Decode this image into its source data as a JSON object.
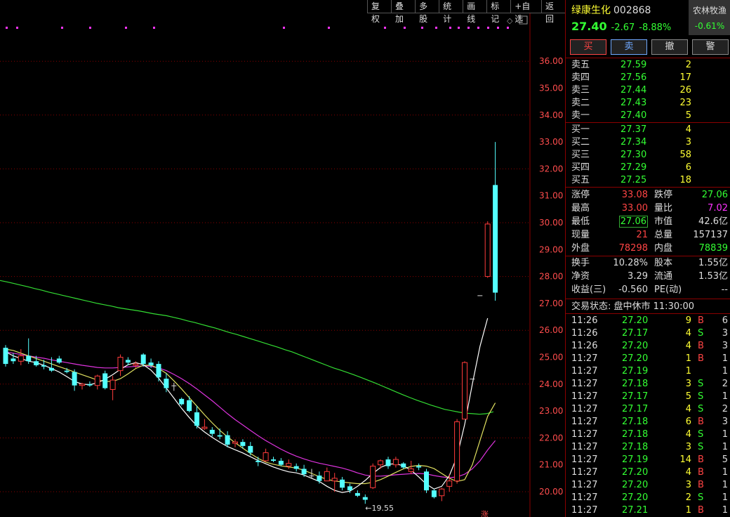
{
  "toolbar": [
    "复权",
    "叠加",
    "多股",
    "统计",
    "画线",
    "标记",
    "+自选",
    "返回"
  ],
  "chart": {
    "y_ticks": [
      "36.00",
      "35.00",
      "34.00",
      "33.00",
      "32.00",
      "31.00",
      "30.00",
      "29.00",
      "28.00",
      "27.00",
      "26.00",
      "25.00",
      "24.00",
      "23.00",
      "22.00",
      "21.00",
      "20.00"
    ],
    "low_label": "19.55",
    "bottom_mark": "涨",
    "candles": [
      [
        25.35,
        25.45,
        24.65,
        24.75
      ],
      [
        24.95,
        25.15,
        24.75,
        24.85
      ],
      [
        24.85,
        25.3,
        24.7,
        25.05
      ],
      [
        25.05,
        25.7,
        24.75,
        24.85
      ],
      [
        24.85,
        25.05,
        24.65,
        24.7
      ],
      [
        24.7,
        24.9,
        24.55,
        24.65
      ],
      [
        24.6,
        25.0,
        24.45,
        24.5
      ],
      [
        24.95,
        25.05,
        24.75,
        24.8
      ],
      [
        24.5,
        24.6,
        24.4,
        24.45
      ],
      [
        24.45,
        24.55,
        23.75,
        23.95
      ],
      [
        23.95,
        24.05,
        23.8,
        24.0
      ],
      [
        24.0,
        24.1,
        23.9,
        23.95
      ],
      [
        23.95,
        24.35,
        23.8,
        24.3
      ],
      [
        24.4,
        24.5,
        23.8,
        23.85
      ],
      [
        23.8,
        24.3,
        23.4,
        24.15
      ],
      [
        24.5,
        25.1,
        24.3,
        25.0
      ],
      [
        24.9,
        25.0,
        24.7,
        24.8
      ],
      [
        24.7,
        24.85,
        24.6,
        24.75
      ],
      [
        25.1,
        25.15,
        24.65,
        24.75
      ],
      [
        24.8,
        24.95,
        24.6,
        24.7
      ],
      [
        24.75,
        24.85,
        24.1,
        24.25
      ],
      [
        24.2,
        24.4,
        23.7,
        23.85
      ],
      [
        23.95,
        24.05,
        23.75,
        23.95
      ],
      [
        23.45,
        23.5,
        23.2,
        23.25
      ],
      [
        23.4,
        23.55,
        22.95,
        23.0
      ],
      [
        22.95,
        23.2,
        22.35,
        22.45
      ],
      [
        22.35,
        22.7,
        22.3,
        22.4
      ],
      [
        22.3,
        22.4,
        22.05,
        22.15
      ],
      [
        22.1,
        22.35,
        21.95,
        22.05
      ],
      [
        22.1,
        22.25,
        21.65,
        21.75
      ],
      [
        21.8,
        21.95,
        21.65,
        21.85
      ],
      [
        21.85,
        21.95,
        21.6,
        21.7
      ],
      [
        21.7,
        21.85,
        21.35,
        21.45
      ],
      [
        21.15,
        21.3,
        20.95,
        21.1
      ],
      [
        21.15,
        21.6,
        21.1,
        21.45
      ],
      [
        21.2,
        21.3,
        21.1,
        21.15
      ],
      [
        21.15,
        21.25,
        20.95,
        21.0
      ],
      [
        20.95,
        21.2,
        20.85,
        21.05
      ],
      [
        20.95,
        21.05,
        20.75,
        20.85
      ],
      [
        20.85,
        21.0,
        20.55,
        20.65
      ],
      [
        20.6,
        20.85,
        20.5,
        20.6
      ],
      [
        20.6,
        20.75,
        20.3,
        20.4
      ],
      [
        20.4,
        20.9,
        20.4,
        20.75
      ],
      [
        20.4,
        20.7,
        20.0,
        20.5
      ],
      [
        20.45,
        20.55,
        20.05,
        20.15
      ],
      [
        20.2,
        20.3,
        19.95,
        20.05
      ],
      [
        19.95,
        20.05,
        19.8,
        19.85
      ],
      [
        19.8,
        19.9,
        19.55,
        19.7
      ],
      [
        20.15,
        21.05,
        20.1,
        20.95
      ],
      [
        21.0,
        21.2,
        20.85,
        21.15
      ],
      [
        21.2,
        21.3,
        20.85,
        20.95
      ],
      [
        21.0,
        21.3,
        20.9,
        21.2
      ],
      [
        21.05,
        21.1,
        20.85,
        20.9
      ],
      [
        20.75,
        21.15,
        20.65,
        20.85
      ],
      [
        20.95,
        21.05,
        20.8,
        20.9
      ],
      [
        20.75,
        20.85,
        19.95,
        20.05
      ],
      [
        20.05,
        20.1,
        19.75,
        19.8
      ],
      [
        19.85,
        20.15,
        19.65,
        20.1
      ],
      [
        20.2,
        20.65,
        20.0,
        20.4
      ],
      [
        20.4,
        22.7,
        20.3,
        22.6
      ],
      [
        22.7,
        24.85,
        22.7,
        24.8
      ],
      [
        24.2,
        24.2,
        24.2,
        24.2
      ],
      [
        27.3,
        27.3,
        27.3,
        27.3
      ],
      [
        28.0,
        30.05,
        27.95,
        29.95
      ],
      [
        31.4,
        33.0,
        27.1,
        27.4
      ]
    ],
    "ma_green": [
      27.85,
      27.8,
      27.74,
      27.68,
      27.62,
      27.55,
      27.49,
      27.42,
      27.36,
      27.3,
      27.24,
      27.18,
      27.12,
      27.06,
      27.0,
      26.95,
      26.9,
      26.84,
      26.8,
      26.76,
      26.72,
      26.67,
      26.62,
      26.58,
      26.54,
      26.48,
      26.42,
      26.35,
      26.29,
      26.22,
      26.15,
      26.08,
      26.0,
      25.92,
      25.85,
      25.77,
      25.69,
      25.61,
      25.53,
      25.45,
      25.37,
      25.28,
      25.2,
      25.1,
      25.0,
      24.9,
      24.8,
      24.7,
      24.6,
      24.52,
      24.43,
      24.34,
      24.24,
      24.14,
      24.04,
      23.93,
      23.82,
      23.71,
      23.6,
      23.5,
      23.4,
      23.31,
      23.22,
      23.14,
      23.06,
      23.01,
      22.96,
      22.92,
      22.9,
      22.88,
      22.9,
      22.97
    ],
    "ma_magenta": [
      25.2,
      25.15,
      25.1,
      25.05,
      25.0,
      24.96,
      24.9,
      24.85,
      24.8,
      24.75,
      24.7,
      24.66,
      24.62,
      24.6,
      24.6,
      24.62,
      24.64,
      24.66,
      24.68,
      24.66,
      24.6,
      24.5,
      24.36,
      24.2,
      24.02,
      23.82,
      23.6,
      23.38,
      23.14,
      22.9,
      22.68,
      22.48,
      22.28,
      22.08,
      21.9,
      21.74,
      21.58,
      21.44,
      21.32,
      21.22,
      21.13,
      21.06,
      21.0,
      20.94,
      20.88,
      20.8,
      20.7,
      20.62,
      20.58,
      20.58,
      20.6,
      20.63,
      20.65,
      20.67,
      20.68,
      20.66,
      20.6,
      20.55,
      20.52,
      20.55,
      20.65,
      20.85,
      21.15,
      21.55,
      21.9
    ],
    "ma_yellow": [
      25.3,
      25.25,
      25.15,
      25.05,
      24.95,
      24.85,
      24.75,
      24.65,
      24.55,
      24.45,
      24.35,
      24.25,
      24.15,
      24.1,
      24.1,
      24.2,
      24.38,
      24.58,
      24.7,
      24.7,
      24.58,
      24.4,
      24.12,
      23.82,
      23.5,
      23.18,
      22.86,
      22.56,
      22.28,
      22.04,
      21.82,
      21.62,
      21.42,
      21.24,
      21.1,
      21.02,
      20.96,
      20.92,
      20.88,
      20.8,
      20.68,
      20.56,
      20.46,
      20.4,
      20.36,
      20.33,
      20.3,
      20.3,
      20.35,
      20.45,
      20.58,
      20.72,
      20.85,
      20.94,
      20.98,
      20.95,
      20.86,
      20.68,
      20.5,
      20.38,
      20.45,
      21.0,
      21.9,
      22.8,
      23.3
    ],
    "ma_white": [
      25.2,
      25.05,
      24.95,
      24.85,
      24.8,
      24.7,
      24.58,
      24.45,
      24.28,
      24.1,
      24.0,
      23.98,
      24.05,
      24.18,
      24.35,
      24.55,
      24.72,
      24.8,
      24.72,
      24.52,
      24.22,
      23.85,
      23.48,
      23.1,
      22.76,
      22.45,
      22.22,
      22.02,
      21.84,
      21.68,
      21.56,
      21.44,
      21.3,
      21.16,
      21.04,
      20.92,
      20.82,
      20.74,
      20.7,
      20.62,
      20.5,
      20.38,
      20.2,
      20.05,
      19.97,
      20.02,
      20.2,
      20.42,
      20.68,
      20.9,
      21.02,
      21.04,
      20.96,
      20.8,
      20.55,
      20.28,
      20.1,
      20.2,
      20.6,
      21.3,
      22.5,
      24.0,
      25.4,
      26.45
    ],
    "signal_dots": [
      8,
      23,
      87,
      127,
      178,
      218,
      403,
      467,
      547,
      575,
      600,
      620,
      640,
      652,
      666,
      680,
      694,
      708,
      722
    ]
  },
  "header": {
    "name": "绿康生化",
    "code": "002868",
    "sector": "农林牧渔",
    "sector_change": "-0.61%"
  },
  "quote": {
    "price": "27.40",
    "change": "-2.67",
    "change_pct": "-8.88%"
  },
  "trade_buttons": [
    "买",
    "卖",
    "撤",
    "警"
  ],
  "asks": [
    {
      "label": "卖五",
      "price": "27.59",
      "vol": "2"
    },
    {
      "label": "卖四",
      "price": "27.56",
      "vol": "17"
    },
    {
      "label": "卖三",
      "price": "27.44",
      "vol": "26"
    },
    {
      "label": "卖二",
      "price": "27.43",
      "vol": "23"
    },
    {
      "label": "卖一",
      "price": "27.40",
      "vol": "5"
    }
  ],
  "bids": [
    {
      "label": "买一",
      "price": "27.37",
      "vol": "4"
    },
    {
      "label": "买二",
      "price": "27.34",
      "vol": "3"
    },
    {
      "label": "买三",
      "price": "27.30",
      "vol": "58"
    },
    {
      "label": "买四",
      "price": "27.29",
      "vol": "6"
    },
    {
      "label": "买五",
      "price": "27.25",
      "vol": "18"
    }
  ],
  "stats1": [
    {
      "l1": "涨停",
      "v1": "33.08",
      "c1": "r",
      "l2": "跌停",
      "v2": "27.06",
      "c2": "g"
    },
    {
      "l1": "最高",
      "v1": "33.00",
      "c1": "r",
      "l2": "量比",
      "v2": "7.02",
      "c2": "m"
    },
    {
      "l1": "最低",
      "v1": "27.06",
      "c1": "g",
      "l2": "市值",
      "v2": "42.6亿",
      "c2": "w"
    },
    {
      "l1": "现量",
      "v1": "21",
      "c1": "r",
      "l2": "总量",
      "v2": "157137",
      "c2": "w"
    },
    {
      "l1": "外盘",
      "v1": "78298",
      "c1": "r",
      "l2": "内盘",
      "v2": "78839",
      "c2": "g"
    }
  ],
  "stats2": [
    {
      "l1": "换手",
      "v1": "10.28%",
      "l2": "股本",
      "v2": "1.55亿"
    },
    {
      "l1": "净资",
      "v1": "3.29",
      "l2": "流通",
      "v2": "1.53亿"
    },
    {
      "l1": "收益(三)",
      "v1": "-0.560",
      "l2": "PE(动)",
      "v2": "--"
    }
  ],
  "trade_status": "交易状态: 盘中休市 11:30:00",
  "ticks": [
    {
      "t": "11:26",
      "p": "27.20",
      "v": "9",
      "s": "B",
      "n": "6"
    },
    {
      "t": "11:26",
      "p": "27.17",
      "v": "4",
      "s": "S",
      "n": "3"
    },
    {
      "t": "11:26",
      "p": "27.20",
      "v": "4",
      "s": "B",
      "n": "3"
    },
    {
      "t": "11:27",
      "p": "27.20",
      "v": "1",
      "s": "B",
      "n": "1"
    },
    {
      "t": "11:27",
      "p": "27.19",
      "v": "1",
      "s": "",
      "n": "1"
    },
    {
      "t": "11:27",
      "p": "27.18",
      "v": "3",
      "s": "S",
      "n": "2"
    },
    {
      "t": "11:27",
      "p": "27.17",
      "v": "5",
      "s": "S",
      "n": "1"
    },
    {
      "t": "11:27",
      "p": "27.17",
      "v": "4",
      "s": "S",
      "n": "2"
    },
    {
      "t": "11:27",
      "p": "27.18",
      "v": "6",
      "s": "B",
      "n": "3"
    },
    {
      "t": "11:27",
      "p": "27.18",
      "v": "4",
      "s": "S",
      "n": "1"
    },
    {
      "t": "11:27",
      "p": "27.18",
      "v": "3",
      "s": "S",
      "n": "1"
    },
    {
      "t": "11:27",
      "p": "27.19",
      "v": "14",
      "s": "B",
      "n": "5"
    },
    {
      "t": "11:27",
      "p": "27.20",
      "v": "4",
      "s": "B",
      "n": "1"
    },
    {
      "t": "11:27",
      "p": "27.20",
      "v": "3",
      "s": "B",
      "n": "1"
    },
    {
      "t": "11:27",
      "p": "27.20",
      "v": "2",
      "s": "S",
      "n": "1"
    },
    {
      "t": "11:27",
      "p": "27.21",
      "v": "1",
      "s": "B",
      "n": "1"
    }
  ]
}
